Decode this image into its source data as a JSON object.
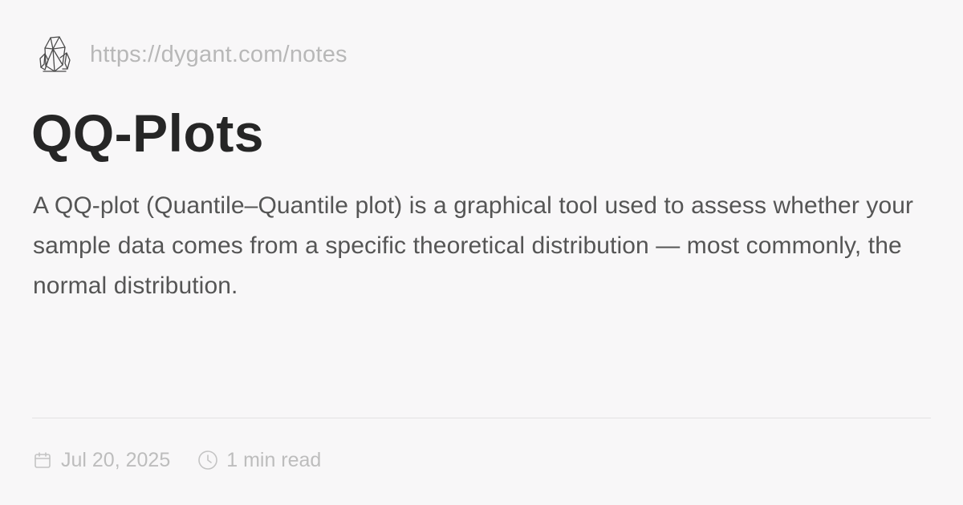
{
  "site": {
    "logo_icon": "crystal-cluster-icon",
    "url": "https://dygant.com/notes"
  },
  "article": {
    "title": "QQ-Plots",
    "description": "A QQ-plot (Quantile–Quantile plot) is a graphical tool used to assess whether your sample data comes from a specific theoretical distribution — most commonly, the normal distribution."
  },
  "meta": {
    "date_icon": "calendar-icon",
    "date": "Jul 20, 2025",
    "read_icon": "clock-icon",
    "read_time": "1 min read"
  },
  "colors": {
    "background": "#f8f7f8",
    "title": "#262626",
    "body_text": "#555555",
    "muted_text": "#bdbdbd",
    "divider": "#e2e1e3"
  }
}
